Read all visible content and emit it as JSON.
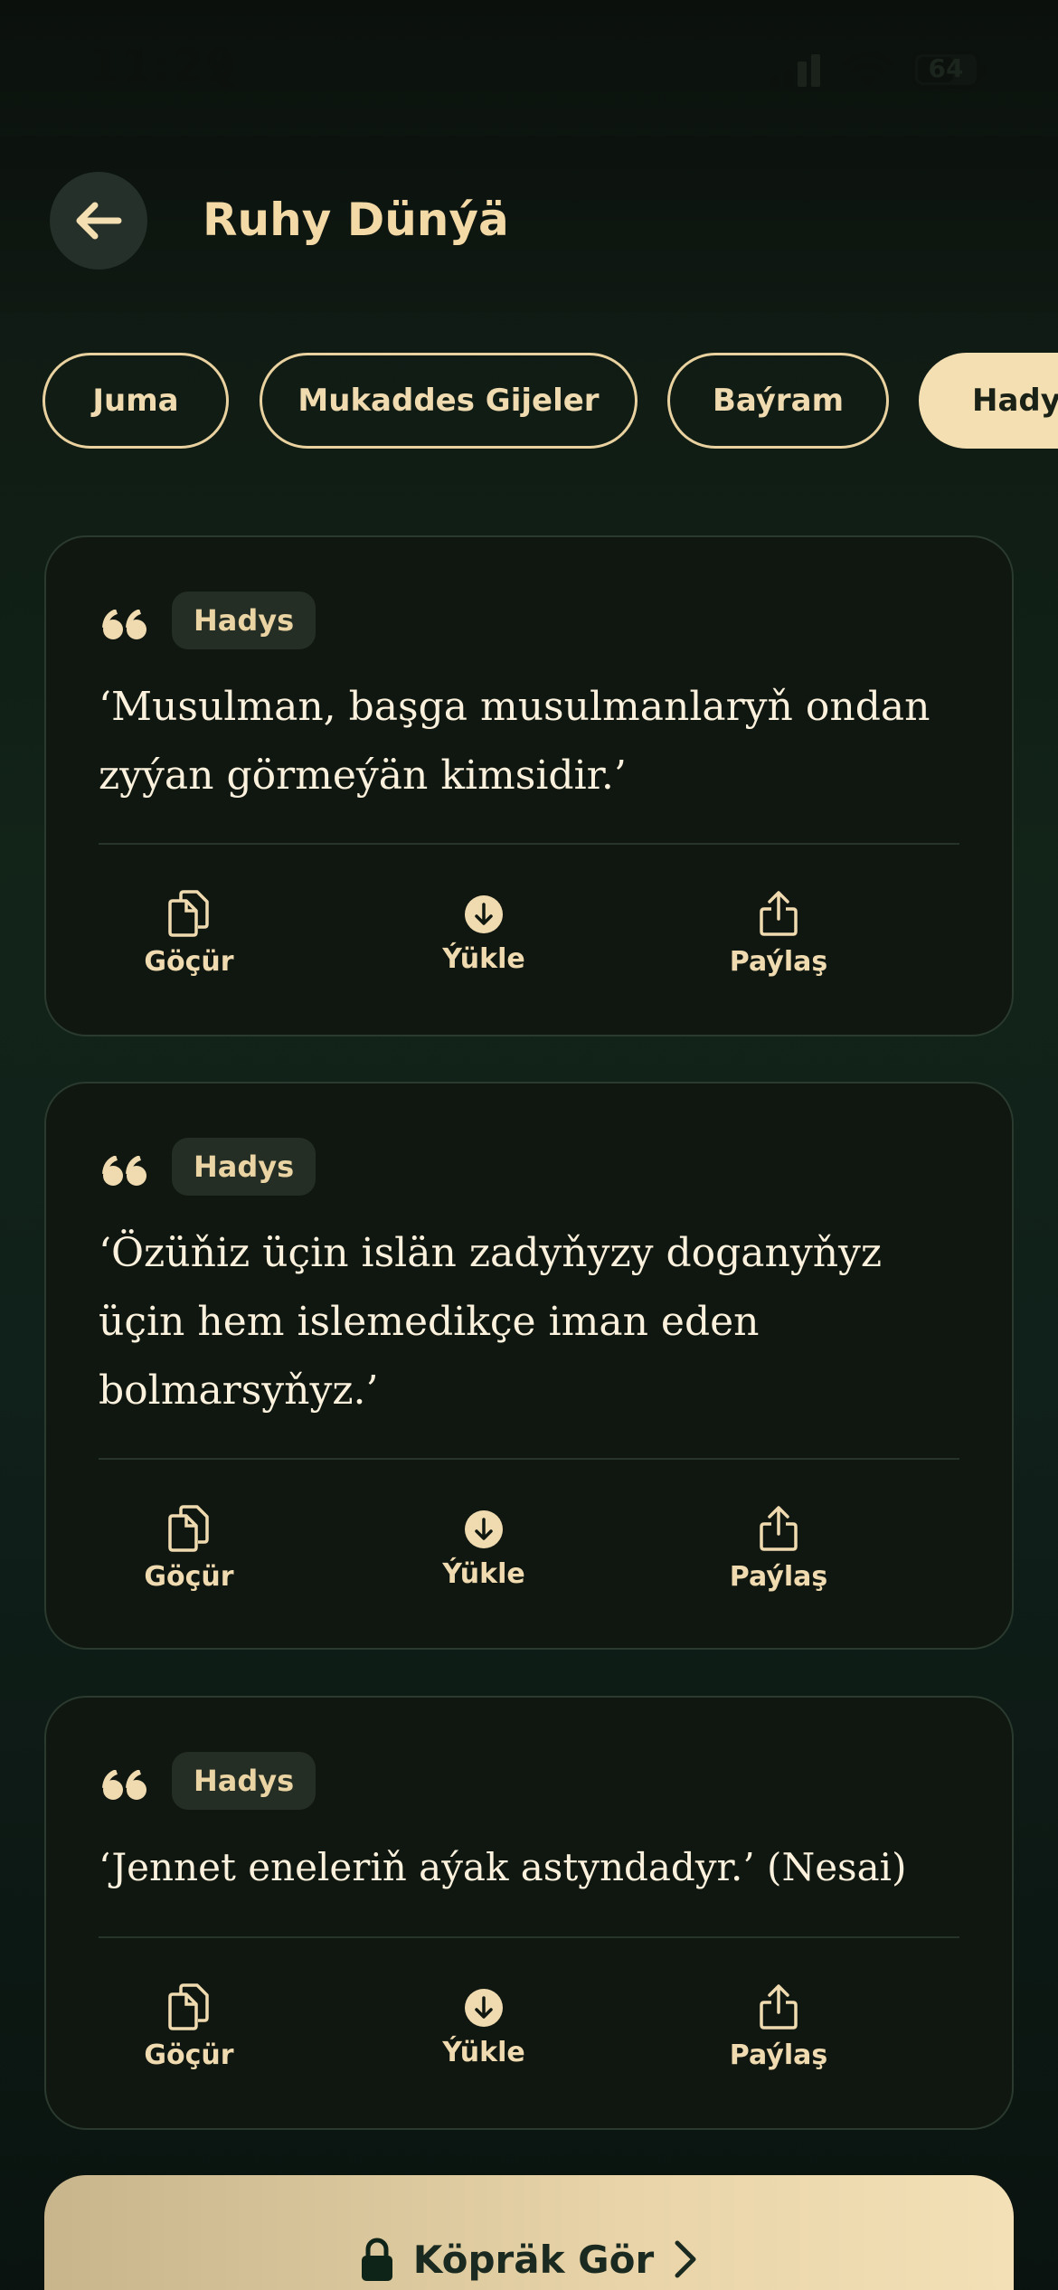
{
  "status_bar": {
    "time": "11:29",
    "battery": "64"
  },
  "header": {
    "title": "Ruhy Dünýä"
  },
  "chips": [
    {
      "label": "Juma",
      "active": false
    },
    {
      "label": "Mukaddes Gijeler",
      "active": false
    },
    {
      "label": "Baýram",
      "active": false
    },
    {
      "label": "Hadys",
      "active": true
    }
  ],
  "actions": {
    "copy": "Göçür",
    "download": "Ýükle",
    "share": "Paýlaş"
  },
  "cards": [
    {
      "tag": "Hadys",
      "text": "‘Musulman, başga musulmanlaryň ondan zyýan görmeýän kimsidir.’"
    },
    {
      "tag": "Hadys",
      "text": "‘Özüňiz üçin islän zadyňyzy doganyňyz üçin hem islemedikçe iman eden bolmarsyňyz.’"
    },
    {
      "tag": "Hadys",
      "text": "‘Jennet eneleriň aýak astyndadyr.’ (Nesai)"
    }
  ],
  "more_button": {
    "label": "Köpräk Gör"
  },
  "colors": {
    "accent": "#f4dfb2",
    "card_bg": "#0f1710",
    "text": "#fbf1dc"
  }
}
